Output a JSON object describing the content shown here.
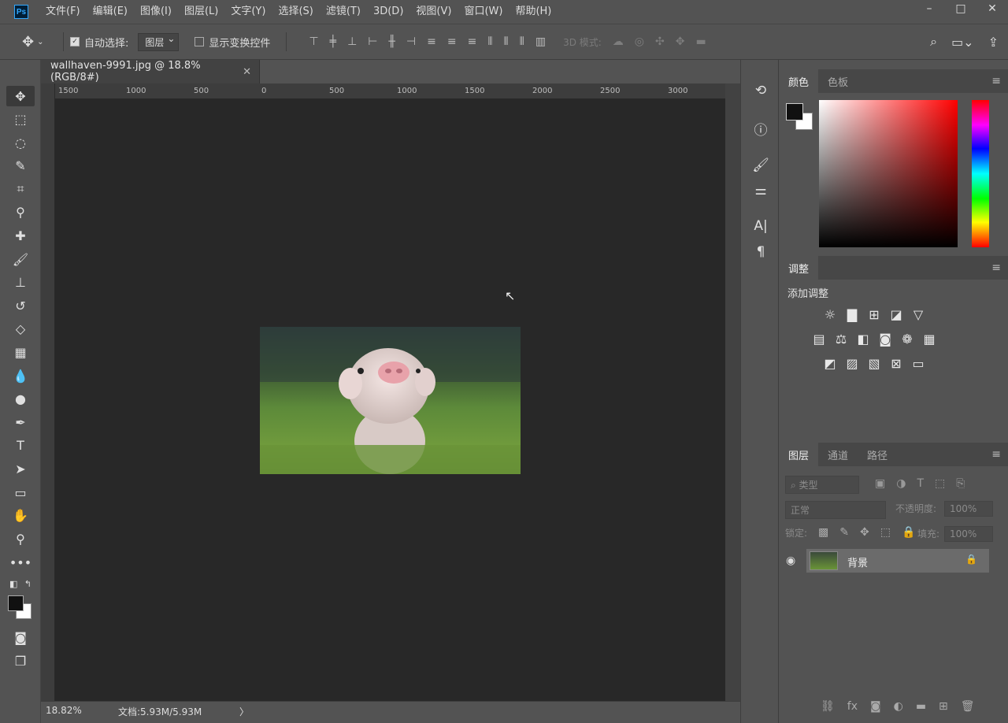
{
  "menubar": {
    "logo": "Ps",
    "items": [
      "文件(F)",
      "编辑(E)",
      "图像(I)",
      "图层(L)",
      "文字(Y)",
      "选择(S)",
      "滤镜(T)",
      "3D(D)",
      "视图(V)",
      "窗口(W)",
      "帮助(H)"
    ],
    "window_controls": [
      "–",
      "□",
      "✕"
    ]
  },
  "options": {
    "move_icon": "✥",
    "auto_select_label": "自动选择:",
    "auto_select_value": "图层",
    "transform_label": "显示变换控件",
    "mode_3d_label": "3D 模式:"
  },
  "document": {
    "tab_title": "wallhaven-9991.jpg @ 18.8%(RGB/8#)",
    "close": "✕",
    "ruler_ticks": [
      "1500",
      "1000",
      "500",
      "0",
      "500",
      "1000",
      "1500",
      "2000",
      "2500",
      "3000"
    ]
  },
  "status": {
    "zoom": "18.82%",
    "doc_info": "文档:5.93M/5.93M",
    "arrow": "〉"
  },
  "panels": {
    "color_tab": "颜色",
    "swatches_tab": "色板",
    "adjust_tab": "调整",
    "add_adjustment": "添加调整",
    "layers_tab": "图层",
    "channels_tab": "通道",
    "paths_tab": "路径",
    "filter_placeholder": "类型",
    "blend_mode": "正常",
    "opacity_label": "不透明度:",
    "opacity_value": "100%",
    "lock_label": "锁定:",
    "fill_label": "填充:",
    "fill_value": "100%",
    "layer_name": "背景"
  },
  "colors": {
    "foreground": "#111111",
    "background": "#ffffff",
    "accent": "#31a8ff"
  }
}
